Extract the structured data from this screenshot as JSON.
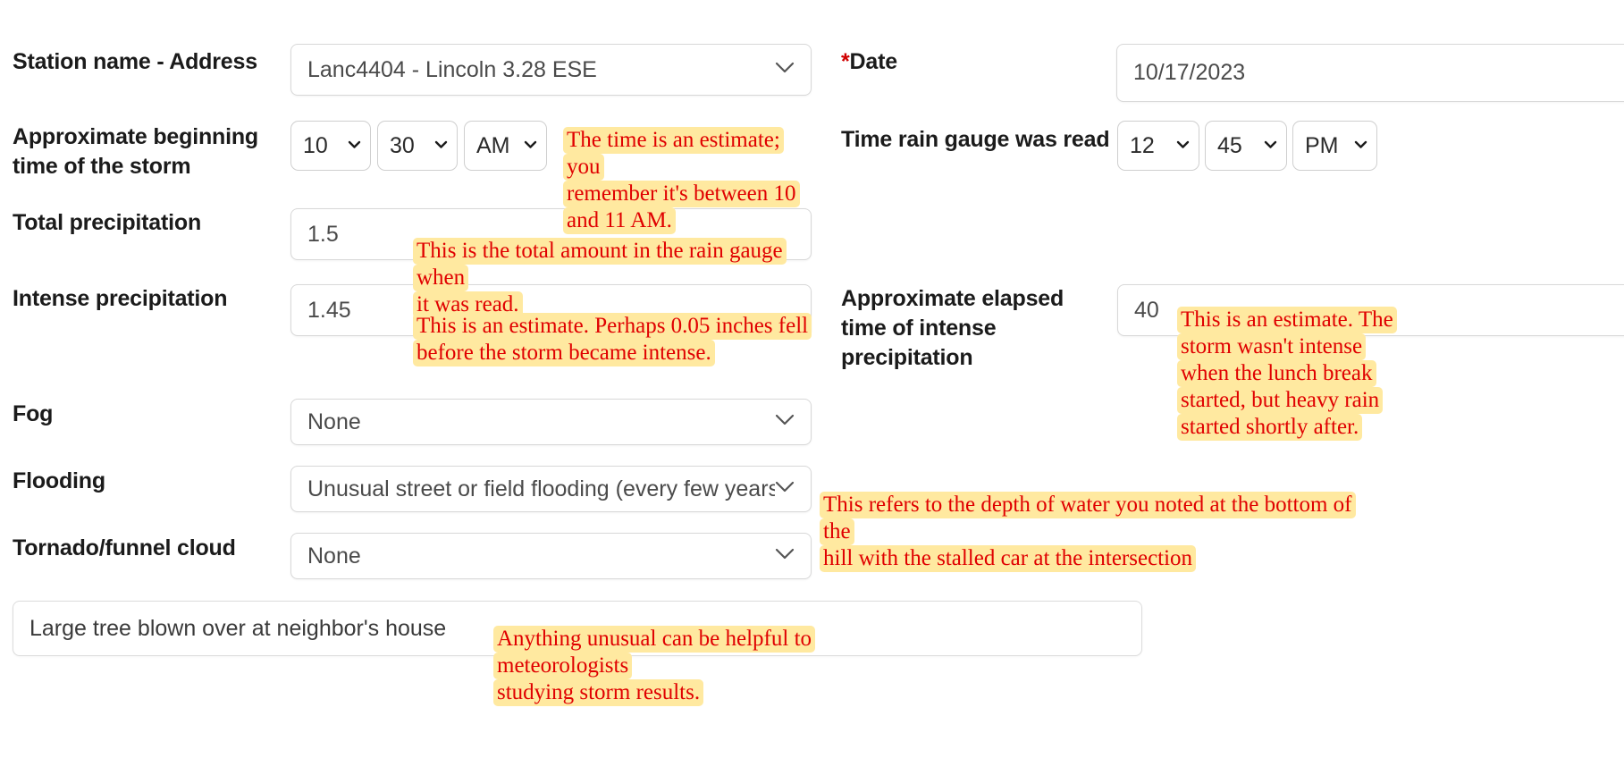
{
  "form": {
    "fields": [
      {
        "label": "Station name - Address",
        "required": false,
        "value": "Lanc4404 - Lincoln 3.28 ESE",
        "kind": "select"
      },
      {
        "label": "Date",
        "required": true,
        "required_marker": "*",
        "value": "10/17/2023",
        "kind": "text"
      },
      {
        "label": "Approximate beginning time of the storm",
        "label_line1": "Approximate beginning",
        "label_line2": "time of the storm",
        "kind": "time",
        "hour": "10",
        "minute": "30",
        "meridiem": "AM"
      },
      {
        "label": "Time rain gauge was read",
        "kind": "time",
        "hour": "12",
        "minute": "45",
        "meridiem": "PM"
      },
      {
        "label": "Total precipitation",
        "value": "1.5",
        "kind": "text"
      },
      {
        "label": "Intense precipitation",
        "value": "1.45",
        "kind": "text"
      },
      {
        "label": "Approximate elapsed time of intense precipitation",
        "label_line1": "Approximate elapsed",
        "label_line2": "time of intense",
        "label_line3": "precipitation",
        "value": "40",
        "kind": "text"
      },
      {
        "label": "Fog",
        "value": "None",
        "kind": "select"
      },
      {
        "label": "Flooding",
        "value": "Unusual street or field flooding (every few years)",
        "kind": "select"
      },
      {
        "label": "Tornado/funnel cloud",
        "value": "None",
        "kind": "select"
      },
      {
        "label": "",
        "value": "Large tree blown over at neighbor's house",
        "kind": "textarea"
      }
    ]
  },
  "annotations": [
    {
      "id": "storm-time",
      "text": "The time is an estimate; you\nremember it's between 10\nand 11 AM."
    },
    {
      "id": "total-precip",
      "text": "This is the total amount in the rain gauge when\nit was read."
    },
    {
      "id": "intense-precip",
      "text": "This is an estimate. Perhaps 0.05 inches fell\nbefore the storm became intense."
    },
    {
      "id": "elapsed-time",
      "text": "This is an estimate. The\nstorm wasn't intense\nwhen the lunch break\nstarted, but heavy rain\nstarted shortly after."
    },
    {
      "id": "flooding",
      "text": "This refers to the depth of water you noted at the bottom of the\nhill with the stalled car at the intersection"
    },
    {
      "id": "notes",
      "text": "Anything unusual can be helpful to meteorologists\nstudying storm results."
    }
  ],
  "icons": {
    "chevron_down": "chevron-down-icon"
  },
  "colors": {
    "annotation_text": "#e00000",
    "annotation_highlight": "#ffe9a0",
    "required_marker": "#d00000",
    "label_text": "#1b1b1b",
    "field_border": "#d8d8d8"
  }
}
